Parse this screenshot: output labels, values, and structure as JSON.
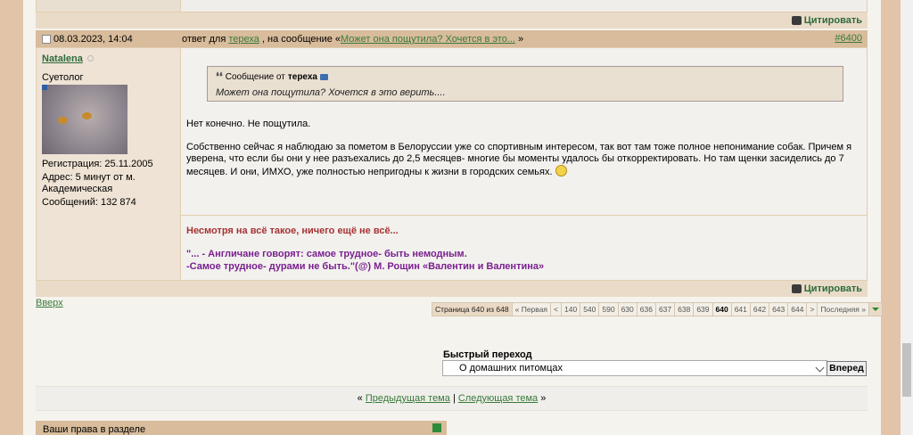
{
  "post": {
    "cite_label": "Цитировать",
    "date": "08.03.2023, 14:04",
    "reply_prefix": "ответ для",
    "reply_to_user": "тереха",
    "reply_mid": ", на сообщение «",
    "reply_link": "Может она пощутила? Хочется в это...",
    "reply_end": "»",
    "number": "#6400",
    "user": {
      "name": "Natalena",
      "title": "Суетолог",
      "reg": "Регистрация:  25.11.2005",
      "address": "Адрес:       5 минут от м. Академическая",
      "messages": "Сообщений:  132 874"
    },
    "quote": {
      "from_prefix": "Сообщение от",
      "from_user": "тереха",
      "text": "Может она пощутила? Хочется в это верить...."
    },
    "text1": "Нет конечно. Не пощутила.",
    "text2": "Собственно сейчас я наблюдаю за пометом в Белоруссии уже со спортивным интересом, так вот там тоже полное непонимание собак. Причем я уверена, что если бы они у нее разъехались до 2,5 месяцев- многие бы моменты удалось бы откорректировать. Но там щенки засиделись до 7 месяцев. И они, ИМХО, уже полностью непригодны к жизни в городских семьях.",
    "sig1": "Несмотря на всё такое, ничего ещё не всё...",
    "sig2": "\"... - Англичане говорят: самое трудное- быть немодным.",
    "sig3": "-Самое трудное- дурами не быть.\"(@) М. Рощин «Валентин и Валентина»"
  },
  "top_link": "Вверх",
  "pager": {
    "summary": "Страница 640 из 648",
    "first": "« Первая",
    "prev": "<",
    "pages": [
      "140",
      "540",
      "590",
      "630",
      "636",
      "637",
      "638",
      "639",
      "640",
      "641",
      "642",
      "643",
      "644"
    ],
    "current": "640",
    "next": ">",
    "last": "Последняя »"
  },
  "jump": {
    "label": "Быстрый переход",
    "selected": "О домашних питомцах",
    "button": "Вперед"
  },
  "nav": {
    "open": "«",
    "prev": "Предыдущая тема",
    "sep": "|",
    "next": "Следующая тема",
    "close": "»"
  },
  "perms": "Ваши права в разделе"
}
